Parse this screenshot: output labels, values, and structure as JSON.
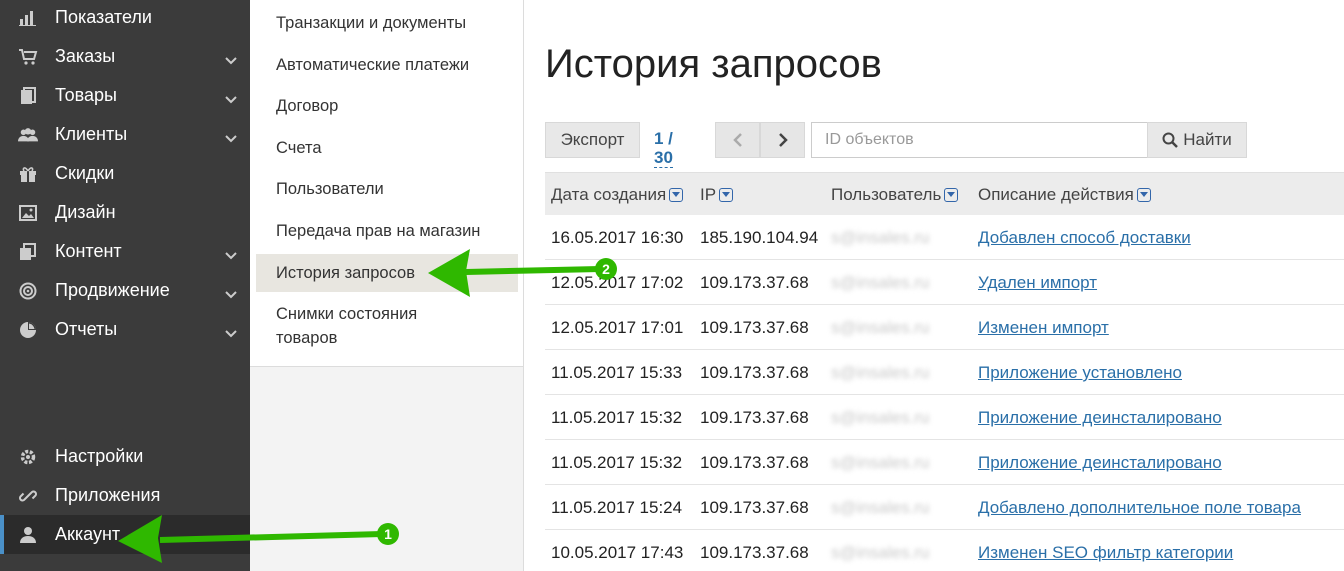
{
  "sidebar": {
    "items": [
      {
        "label": "Показатели",
        "icon": "chart-icon",
        "has_chevron": false
      },
      {
        "label": "Заказы",
        "icon": "cart-icon",
        "has_chevron": true
      },
      {
        "label": "Товары",
        "icon": "products-icon",
        "has_chevron": true
      },
      {
        "label": "Клиенты",
        "icon": "users-icon",
        "has_chevron": true
      },
      {
        "label": "Скидки",
        "icon": "gift-icon",
        "has_chevron": false
      },
      {
        "label": "Дизайн",
        "icon": "image-icon",
        "has_chevron": false
      },
      {
        "label": "Контент",
        "icon": "pages-icon",
        "has_chevron": true
      },
      {
        "label": "Продвижение",
        "icon": "target-icon",
        "has_chevron": true
      },
      {
        "label": "Отчеты",
        "icon": "pie-icon",
        "has_chevron": true
      }
    ],
    "bottom_items": [
      {
        "label": "Настройки",
        "icon": "gear-icon"
      },
      {
        "label": "Приложения",
        "icon": "link-icon"
      },
      {
        "label": "Аккаунт",
        "icon": "user-icon",
        "active": true
      }
    ]
  },
  "submenu": {
    "items": [
      "Транзакции и документы",
      "Автоматические платежи",
      "Договор",
      "Счета",
      "Пользователи",
      "Передача прав на магазин",
      "История запросов",
      "Снимки состояния товаров"
    ],
    "active_index": 6,
    "last_line_1": "Снимки состояния",
    "last_line_2": "товаров"
  },
  "main": {
    "title": "История запросов",
    "export_label": "Экспорт",
    "pager": "1 / 30",
    "search_placeholder": "ID объектов",
    "find_label": "Найти",
    "columns": [
      "Дата создания",
      "IP",
      "Пользователь",
      "Описание действия"
    ],
    "rows": [
      {
        "date": "16.05.2017 16:30",
        "ip": "185.190.104.94",
        "user": "s@insales.ru",
        "action": "Добавлен способ доставки"
      },
      {
        "date": "12.05.2017 17:02",
        "ip": "109.173.37.68",
        "user": "s@insales.ru",
        "action": "Удален импорт"
      },
      {
        "date": "12.05.2017 17:01",
        "ip": "109.173.37.68",
        "user": "s@insales.ru",
        "action": "Изменен импорт"
      },
      {
        "date": "11.05.2017 15:33",
        "ip": "109.173.37.68",
        "user": "s@insales.ru",
        "action": "Приложение установлено"
      },
      {
        "date": "11.05.2017 15:32",
        "ip": "109.173.37.68",
        "user": "s@insales.ru",
        "action": "Приложение деинсталировано"
      },
      {
        "date": "11.05.2017 15:32",
        "ip": "109.173.37.68",
        "user": "s@insales.ru",
        "action": "Приложение деинсталировано"
      },
      {
        "date": "11.05.2017 15:24",
        "ip": "109.173.37.68",
        "user": "s@insales.ru",
        "action": "Добавлено дополнительное поле товара"
      },
      {
        "date": "10.05.2017 17:43",
        "ip": "109.173.37.68",
        "user": "s@insales.ru",
        "action": "Изменен SEO фильтр категории"
      }
    ]
  },
  "annotations": {
    "marker_1": "1",
    "marker_2": "2",
    "arrow_color": "#2fb800"
  },
  "colors": {
    "sidebar_bg": "#3b3b3b",
    "link": "#2a6fa8",
    "header_bg": "#ececec"
  }
}
